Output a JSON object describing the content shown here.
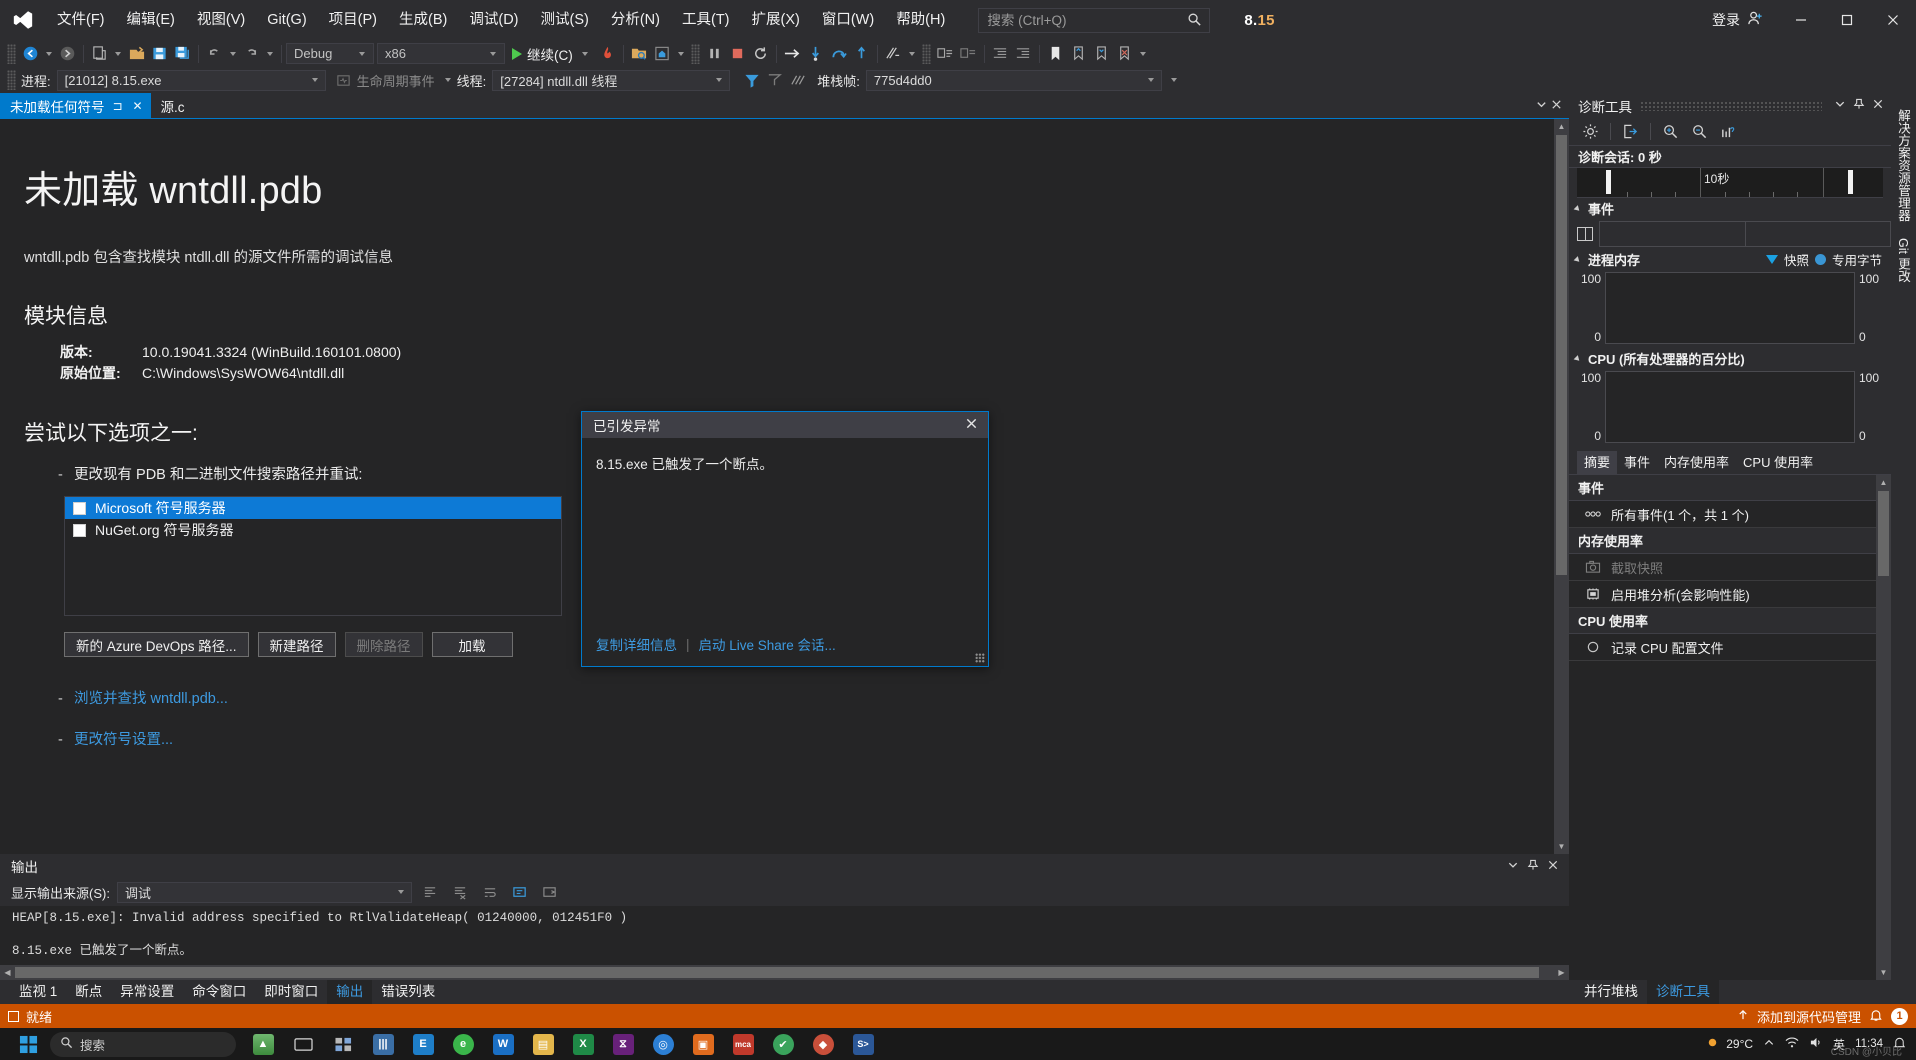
{
  "titlebar": {
    "logo_icon": "visual-studio-logo",
    "menus": [
      "文件(F)",
      "编辑(E)",
      "视图(V)",
      "Git(G)",
      "项目(P)",
      "生成(B)",
      "调试(D)",
      "测试(S)",
      "分析(N)",
      "工具(T)",
      "扩展(X)",
      "窗口(W)",
      "帮助(H)"
    ],
    "search_placeholder": "搜索 (Ctrl+Q)",
    "search_value": "",
    "search_icon": "search-icon",
    "window_title_a": "8.",
    "window_title_b": "15",
    "signin_label": "登录",
    "live_share_label": "Live Share",
    "minimize": "—",
    "maximize": "▢",
    "close": "✕"
  },
  "toolbar": {
    "navigate_back_icon": "navigate-back-icon",
    "navigate_forward_icon": "navigate-forward-icon",
    "new_item_icon": "new-item-icon",
    "open_file_icon": "open-file-icon",
    "save_icon": "save-icon",
    "save_all_icon": "save-all-icon",
    "undo_icon": "undo-icon",
    "redo_icon": "redo-icon",
    "config_value": "Debug",
    "platform_value": "x86",
    "continue_label": "继续(C)",
    "hot_reload_icon": "hot-reload-icon",
    "attach_icon": "attach-to-process-icon",
    "home_icon": "home-icon",
    "pause_icon": "pause-icon",
    "stop_icon": "stop-icon",
    "restart_icon": "restart-icon",
    "show_next_statement_icon": "show-next-statement-icon",
    "step_into_icon": "step-into-icon",
    "step_over_icon": "step-over-icon",
    "step_out_icon": "step-out-icon",
    "diff_icon": "compare-icon",
    "comment_icon": "comment-icon",
    "uncomment_icon": "uncomment-icon",
    "outdent_icon": "outdent-icon",
    "indent_icon": "indent-icon",
    "bookmark_icon": "bookmark-icon",
    "bookmark_prev_icon": "bookmark-prev-icon",
    "bookmark_next_icon": "bookmark-next-icon",
    "bookmark_clear_icon": "bookmark-clear-icon"
  },
  "context_bar": {
    "process_label": "进程:",
    "process_value": "[21012] 8.15.exe",
    "lifecycle_label": "生命周期事件",
    "thread_label": "线程:",
    "thread_value": "[27284] ntdll.dll 线程",
    "stackframe_label": "堆栈帧:",
    "stackframe_value": "775d4dd0",
    "filter_icon": "filter-icon",
    "flag_icon": "flag-icon",
    "threads_icon": "threads-icon"
  },
  "doc_tabs": {
    "tabs": [
      {
        "label": "未加载任何符号",
        "active": true,
        "pin": "⊐",
        "close": "✕"
      },
      {
        "label": "源.c",
        "active": false
      }
    ]
  },
  "document": {
    "title": "未加载 wntdll.pdb",
    "subtitle": "wntdll.pdb 包含查找模块 ntdll.dll 的源文件所需的调试信息",
    "module_info_heading": "模块信息",
    "fields": [
      {
        "key": "版本:",
        "value": "10.0.19041.3324 (WinBuild.160101.0800)"
      },
      {
        "key": "原始位置:",
        "value": "C:\\Windows\\SysWOW64\\ntdll.dll"
      }
    ],
    "options_heading": "尝试以下选项之一:",
    "option1": "更改现有 PDB 和二进制文件搜索路径并重试:",
    "symbol_servers": [
      {
        "label": "Microsoft 符号服务器",
        "checked": false,
        "selected": true
      },
      {
        "label": "NuGet.org 符号服务器",
        "checked": false,
        "selected": false
      }
    ],
    "buttons": [
      {
        "label": "新的 Azure DevOps 路径...",
        "disabled": false
      },
      {
        "label": "新建路径",
        "disabled": false
      },
      {
        "label": "删除路径",
        "disabled": true
      },
      {
        "label": "加载",
        "disabled": false
      }
    ],
    "link_browse": "浏览并查找 wntdll.pdb...",
    "link_settings": "更改符号设置..."
  },
  "exception_dialog": {
    "title": "已引发异常",
    "close_icon": "close-icon",
    "message": "8.15.exe 已触发了一个断点。",
    "link_copy": "复制详细信息",
    "link_liveshare": "启动 Live Share 会话..."
  },
  "diagnostics": {
    "title": "诊断工具",
    "dropdown_icon": "chevron-down-icon",
    "pin_icon": "pin-icon",
    "close_icon": "close-icon",
    "toolbar_icons": [
      "settings-icon",
      "export-icon",
      "zoom-in-icon",
      "zoom-out-icon",
      "reset-view-icon"
    ],
    "session_label": "诊断会话: 0 秒",
    "timeline_label": "10秒",
    "events_section": "事件",
    "memory_section": "进程内存",
    "legend_snapshot": "快照",
    "legend_private_bytes": "专用字节",
    "memory_axis": {
      "top": "100",
      "bottom": "0",
      "top_right": "100",
      "bottom_right": "0"
    },
    "cpu_section": "CPU (所有处理器的百分比)",
    "cpu_axis": {
      "top": "100",
      "bottom": "0",
      "top_right": "100",
      "bottom_right": "0"
    },
    "tabs": [
      {
        "label": "摘要",
        "active": true
      },
      {
        "label": "事件",
        "active": false
      },
      {
        "label": "内存使用率",
        "active": false
      },
      {
        "label": "CPU 使用率",
        "active": false
      }
    ],
    "summary": [
      {
        "type": "header",
        "label": "事件"
      },
      {
        "type": "item",
        "label": "所有事件(1 个，共 1 个)",
        "icon": "events-icon",
        "disabled": false
      },
      {
        "type": "header",
        "label": "内存使用率"
      },
      {
        "type": "item",
        "label": "截取快照",
        "icon": "camera-icon",
        "disabled": true
      },
      {
        "type": "item",
        "label": "启用堆分析(会影响性能)",
        "icon": "heap-icon",
        "disabled": false
      },
      {
        "type": "header",
        "label": "CPU 使用率"
      },
      {
        "type": "item",
        "label": "记录 CPU 配置文件",
        "icon": "record-icon",
        "disabled": false
      }
    ],
    "bottom_tabs": [
      {
        "label": "并行堆栈",
        "active": false
      },
      {
        "label": "诊断工具",
        "active": true
      }
    ]
  },
  "dock_strip": {
    "tabs": [
      "解决方案资源管理器",
      "Git 更改"
    ]
  },
  "output_panel": {
    "title": "输出",
    "dropdown_icon": "chevron-down-icon",
    "pin_icon": "pin-icon",
    "close_icon": "close-icon",
    "source_label": "显示输出来源(S):",
    "source_value": "调试",
    "toolbar_icons": [
      "find-message-icon",
      "clear-all-icon",
      "toggle-wordwrap-icon",
      "go-to-message-icon",
      "toggle-output-icon"
    ],
    "lines": [
      "HEAP[8.15.exe]: Invalid address specified to RtlValidateHeap( 01240000, 012451F0 )",
      "8.15.exe 已触发了一个断点。"
    ]
  },
  "bottom_tabs": {
    "tabs": [
      {
        "label": "监视 1",
        "active": false
      },
      {
        "label": "断点",
        "active": false
      },
      {
        "label": "异常设置",
        "active": false
      },
      {
        "label": "命令窗口",
        "active": false
      },
      {
        "label": "即时窗口",
        "active": false
      },
      {
        "label": "输出",
        "active": true
      },
      {
        "label": "错误列表",
        "active": false
      }
    ]
  },
  "statusbar": {
    "status_text": "就绪",
    "source_control": "添加到源代码管理",
    "up_icon": "arrow-up-icon",
    "bell_icon": "bell-icon",
    "notification_count": "1"
  },
  "taskbar": {
    "start_icon": "windows-start-icon",
    "search_placeholder": "搜索",
    "search_icon": "search-icon",
    "items": [
      "task-view-icon",
      "widgets-icon",
      "explorer-icon",
      "edge-icon",
      "store-icon",
      "excel-icon",
      "vs-icon",
      "chrome-icon",
      "wps-icon",
      "mcafee-icon",
      "app-icon",
      "app2-icon",
      "terminal-icon"
    ],
    "weather_temp": "29°C",
    "clock_time": "11:34",
    "watermark": "CSDN @小贝比"
  },
  "colors": {
    "accent": "#007acc",
    "status_bar": "#ca5100",
    "selection": "#0d7ad6",
    "link": "#3d9ae0"
  }
}
